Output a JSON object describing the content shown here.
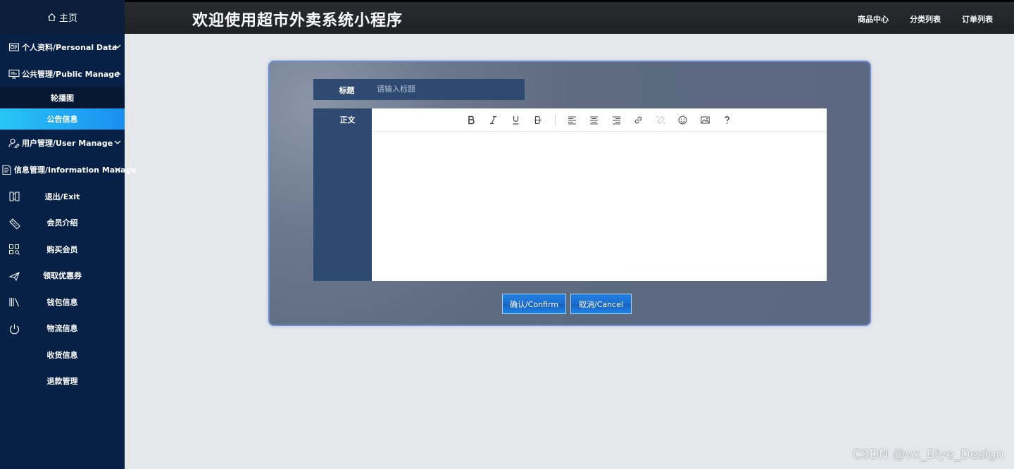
{
  "app": {
    "title": "欢迎使用超市外卖系统小程序"
  },
  "topnav": [
    "商品中心",
    "分类列表",
    "订单列表"
  ],
  "sidebar": {
    "home": "主页",
    "groups": {
      "personal": "个人资料/Personal Data",
      "public": "公共管理/Public Manage",
      "public_sub": [
        "轮播图",
        "公告信息"
      ],
      "user": "用户管理/User Manage",
      "info": "信息管理/Information Manage"
    },
    "items": [
      "退出/Exit",
      "会员介绍",
      "购买会员",
      "领取优惠券",
      "钱包信息",
      "物流信息",
      "收货信息",
      "退款管理"
    ]
  },
  "form": {
    "title_label": "标题",
    "title_placeholder": "请输入标题",
    "title_value": "",
    "body_label": "正文",
    "confirm_label": "确认/Confirm",
    "cancel_label": "取消/Cancel"
  },
  "editor": {
    "toolbar": [
      "bold-icon",
      "italic-icon",
      "underline-icon",
      "strikethrough-icon",
      "align-left-icon",
      "align-center-icon",
      "align-right-icon",
      "link-icon",
      "unlink-icon",
      "emoji-icon",
      "image-icon",
      "help-icon"
    ]
  },
  "colors": {
    "sidebar_bg": "#072046",
    "active_item": "#29c5f6",
    "topbar_bg": "#2b2c30",
    "field_bg": "#2f4a72",
    "button": "#1f7fe0"
  },
  "watermark": "CSDN @vx_Biye_Design"
}
